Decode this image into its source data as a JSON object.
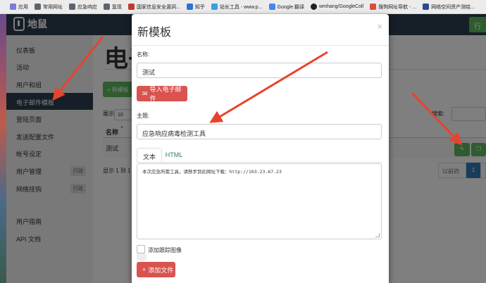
{
  "bookmarks": [
    {
      "label": "应用",
      "color": "#7b7bd8"
    },
    {
      "label": "常用网址",
      "color": "#5b6470"
    },
    {
      "label": "应急响应",
      "color": "#5b6470"
    },
    {
      "label": "复现",
      "color": "#5b6470"
    },
    {
      "label": "国家信息安全漏洞...",
      "color": "#c0392b"
    },
    {
      "label": "知乎",
      "color": "#2f6fd6"
    },
    {
      "label": "站长工具 - www.p...",
      "color": "#3aa0e0"
    },
    {
      "label": "Google 翻译",
      "color": "#4285f4"
    },
    {
      "label": "wmhang/GoogleColl",
      "color": "#222222"
    },
    {
      "label": "搜狗网址导航 - ...",
      "color": "#e04a3a"
    },
    {
      "label": "网络空间资产测绘...",
      "color": "#2a4a8a"
    }
  ],
  "app": {
    "name": "地鼠"
  },
  "sidebar": {
    "items": [
      {
        "label": "仪表板"
      },
      {
        "label": "活动"
      },
      {
        "label": "用户和组"
      },
      {
        "label": "电子邮件模板",
        "active": true
      },
      {
        "label": "登陆页面"
      },
      {
        "label": "发送配置文件"
      },
      {
        "label": "帐号设定"
      },
      {
        "label": "用户管理",
        "badge": "行政"
      },
      {
        "label": "网络挂钩",
        "badge": "行政"
      },
      {
        "label": "用户指南"
      },
      {
        "label": "API 文档"
      }
    ]
  },
  "main": {
    "title": "电子",
    "new_button": "+ 新模板",
    "show_label": "展示",
    "show_value": "10",
    "search_label": "搜索:",
    "column_name": "名称",
    "rows": [
      {
        "name": "测试"
      }
    ],
    "info": "显示 1 到 1",
    "prev": "以前的",
    "page": "1"
  },
  "modal": {
    "title": "新模板",
    "close": "×",
    "name_label": "名称:",
    "name_value": "测试",
    "import_button": "导入电子邮件",
    "subject_label": "主题:",
    "subject_value": "应急响应病毒检测工具",
    "tabs": [
      "文本",
      "HTML"
    ],
    "body_text": "本次应急所需工具，请移步到此网址下载：http://103.23.67.23",
    "tracking_label": "添加跟踪图像",
    "add_files_button": "添加文件"
  },
  "colors": {
    "navbar": "#2d3e4e",
    "green": "#5cb85c",
    "red": "#d9534f",
    "blue": "#337ab7",
    "arrow": "#e8432e"
  }
}
